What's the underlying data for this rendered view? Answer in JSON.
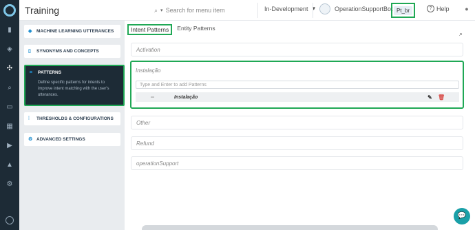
{
  "app": {
    "title": "Training"
  },
  "topbar": {
    "search_placeholder": "Search for menu item",
    "environment": "In-Development",
    "bot_name": "OperationSupportBot",
    "language": "Pt_br",
    "help_label": "Help"
  },
  "side_menu": {
    "items": [
      {
        "label": "MACHINE LEARNING UTTERANCES",
        "icon": "ml-icon"
      },
      {
        "label": "SYNONYMS AND CONCEPTS",
        "icon": "book-icon"
      },
      {
        "label": "PATTERNS",
        "icon": "patterns-icon",
        "description": "Define specific patterns for intents to improve intent matching with the user's utterances."
      },
      {
        "label": "THRESHOLDS & CONFIGURATIONS",
        "icon": "sliders-icon"
      },
      {
        "label": "ADVANCED SETTINGS",
        "icon": "gear-icon"
      }
    ]
  },
  "main": {
    "tabs": [
      "Intent Patterns",
      "Entity Patterns"
    ],
    "sections": [
      {
        "name": "Activation"
      },
      {
        "name": "Instalação",
        "input_placeholder": "Type and Enter to add Patterns",
        "patterns": [
          "Instalação"
        ]
      },
      {
        "name": "Other"
      },
      {
        "name": "Refund"
      },
      {
        "name": "operationSupport"
      }
    ]
  },
  "colors": {
    "highlight": "#1fa855",
    "sidebar_dark": "#1d2b36",
    "accent": "#1f8fd0"
  }
}
